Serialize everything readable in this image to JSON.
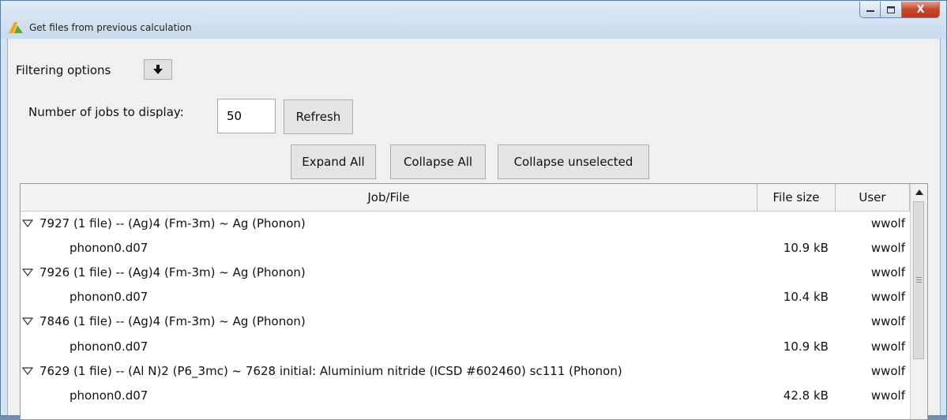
{
  "window": {
    "title": "Get files from previous calculation",
    "min_icon": "minimize-icon",
    "max_icon": "maximize-icon",
    "close_icon": "close-icon",
    "close_glyph": "X"
  },
  "filter": {
    "label": "Filtering options",
    "toggle_glyph": "🡇"
  },
  "jobs": {
    "label": "Number of jobs to display:",
    "value": "50",
    "refresh_label": "Refresh"
  },
  "actions": {
    "expand_all": "Expand All",
    "collapse_all": "Collapse All",
    "collapse_unselected": "Collapse unselected"
  },
  "table": {
    "headers": [
      "Job/File",
      "File size",
      "User"
    ],
    "rows": [
      {
        "type": "job",
        "text": "7927 (1 file) -- (Ag)4  (Fm-3m) ~ Ag (Phonon)",
        "size": "",
        "user": "wwolf"
      },
      {
        "type": "file",
        "text": "phonon0.d07",
        "size": "10.9 kB",
        "user": "wwolf"
      },
      {
        "type": "job",
        "text": "7926 (1 file) -- (Ag)4  (Fm-3m) ~ Ag (Phonon)",
        "size": "",
        "user": "wwolf"
      },
      {
        "type": "file",
        "text": "phonon0.d07",
        "size": "10.4 kB",
        "user": "wwolf"
      },
      {
        "type": "job",
        "text": "7846 (1 file) -- (Ag)4  (Fm-3m) ~ Ag (Phonon)",
        "size": "",
        "user": "wwolf"
      },
      {
        "type": "file",
        "text": "phonon0.d07",
        "size": "10.9 kB",
        "user": "wwolf"
      },
      {
        "type": "job",
        "text": "7629 (1 file) -- (Al N)2  (P6_3mc) ~ 7628 initial: Aluminium nitride (ICSD #602460) sc111 (Phonon)",
        "size": "",
        "user": "wwolf"
      },
      {
        "type": "file",
        "text": "phonon0.d07",
        "size": "42.8 kB",
        "user": "wwolf"
      }
    ]
  },
  "colors": {
    "titlebar": "#c9dbee",
    "content_bg": "#f0f0f0",
    "close_button": "#c7452a"
  }
}
